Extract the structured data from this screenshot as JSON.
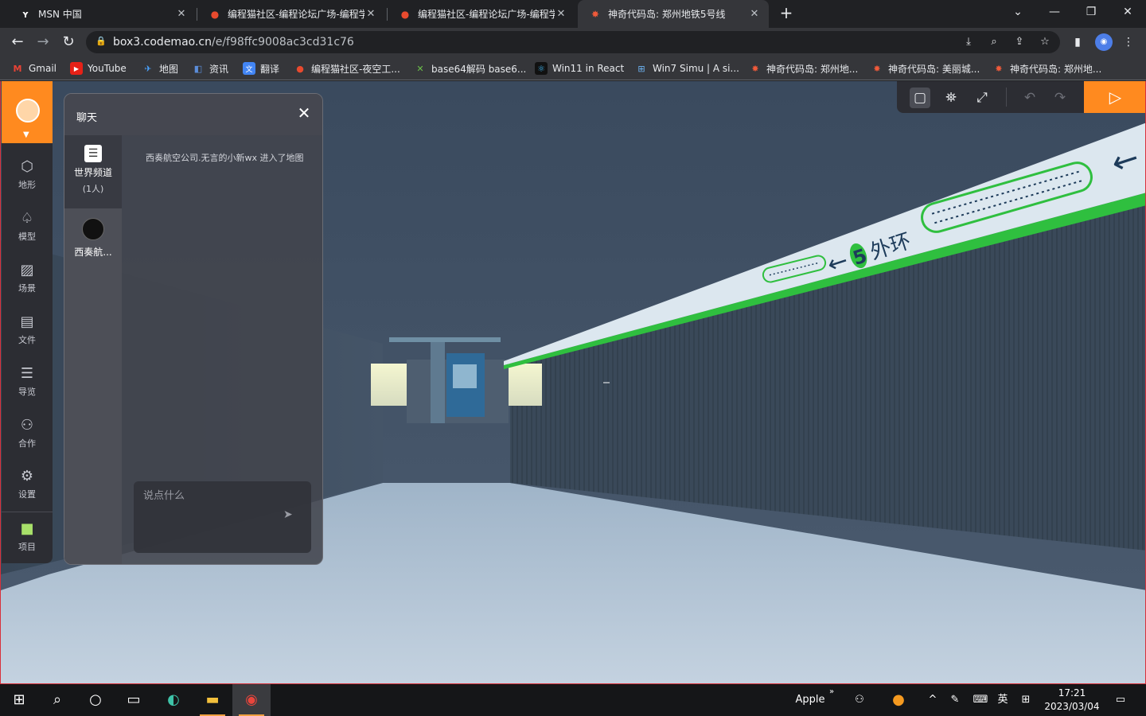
{
  "browser": {
    "tabs": [
      {
        "title": "MSN 中国",
        "favicon": "msn-icon"
      },
      {
        "title": "编程猫社区-编程论坛广场-编程学",
        "favicon": "codemao-icon"
      },
      {
        "title": "编程猫社区-编程论坛广场-编程学",
        "favicon": "codemao-icon"
      },
      {
        "title": "神奇代码岛: 郑州地铁5号线",
        "favicon": "box3-icon"
      }
    ],
    "url_host": "box3.codemao.cn",
    "url_path": "/e/f98ffc9008ac3cd31c76",
    "bookmarks": [
      {
        "label": "Gmail"
      },
      {
        "label": "YouTube"
      },
      {
        "label": "地图"
      },
      {
        "label": "资讯"
      },
      {
        "label": "翻译"
      },
      {
        "label": "编程猫社区-夜空工..."
      },
      {
        "label": "base64解码 base6..."
      },
      {
        "label": "Win11 in React"
      },
      {
        "label": "Win7 Simu | A si..."
      },
      {
        "label": "神奇代码岛: 郑州地..."
      },
      {
        "label": "神奇代码岛: 美丽城..."
      },
      {
        "label": "神奇代码岛: 郑州地..."
      }
    ]
  },
  "sidebar": {
    "items": [
      {
        "label": "地形",
        "icon": "cube-icon"
      },
      {
        "label": "模型",
        "icon": "tree-icon"
      },
      {
        "label": "场景",
        "icon": "image-icon"
      },
      {
        "label": "文件",
        "icon": "folder-icon"
      },
      {
        "label": "导览",
        "icon": "list-icon"
      },
      {
        "label": "合作",
        "icon": "people-icon"
      },
      {
        "label": "设置",
        "icon": "gear-icon"
      },
      {
        "label": "项目",
        "icon": "project-icon"
      }
    ]
  },
  "chat": {
    "title": "聊天",
    "channels": [
      {
        "name": "世界频道",
        "sub": "(1人)"
      },
      {
        "name": "西奏航..."
      }
    ],
    "message": "西奏航空公司.无言的小新wx 进入了地图",
    "input_placeholder": "说点什么"
  },
  "scene": {
    "sign_text": "5 外环",
    "sign_numeral": "5",
    "sign_suffix": "外环",
    "arrow": "←"
  },
  "taskbar": {
    "tray_label": "Apple",
    "ime_label": "英",
    "time": "17:21",
    "date": "2023/03/04"
  },
  "colors": {
    "accent": "#ff8a1f",
    "sign_green": "#2fbf3f"
  }
}
